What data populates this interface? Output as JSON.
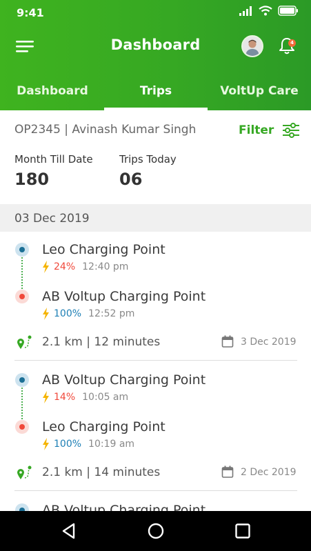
{
  "status_bar": {
    "time": "9:41",
    "icons": [
      "signal-icon",
      "wifi-icon",
      "battery-icon"
    ]
  },
  "app_bar": {
    "title": "Dashboard",
    "notification_count": "4",
    "icons": [
      "menu-icon",
      "avatar",
      "bell-icon"
    ]
  },
  "tabs": [
    {
      "label": "Dashboard",
      "active": false
    },
    {
      "label": "Trips",
      "active": true
    },
    {
      "label": "VoltUp Care",
      "active": false
    }
  ],
  "operator": "OP2345 | Avinash Kumar Singh",
  "filter_label": "Filter",
  "stats": {
    "month_label": "Month Till Date",
    "month_value": "180",
    "today_label": "Trips Today",
    "today_value": "06"
  },
  "date_group": "03 Dec 2019",
  "trips": [
    {
      "start": {
        "name": "Leo Charging Point",
        "percent": "24%",
        "time": "12:40 pm"
      },
      "end": {
        "name": "AB Voltup Charging Point",
        "percent": "100%",
        "time": "12:52 pm"
      },
      "summary": "2.1 km | 12 minutes",
      "date": "3 Dec 2019"
    },
    {
      "start": {
        "name": "AB Voltup Charging Point",
        "percent": "14%",
        "time": "10:05 am"
      },
      "end": {
        "name": "Leo Charging Point",
        "percent": "100%",
        "time": "10:19 am"
      },
      "summary": "2.1 km | 14 minutes",
      "date": "2 Dec 2019"
    },
    {
      "start": {
        "name": "AB Voltup Charging Point"
      }
    }
  ],
  "colors": {
    "brand_green": "#36a823",
    "low_charge": "#f0493b",
    "full_charge": "#1d7fb5",
    "bolt": "#f5b400"
  },
  "nav_bar": {
    "icons": [
      "back-icon",
      "home-icon",
      "recents-icon"
    ]
  }
}
